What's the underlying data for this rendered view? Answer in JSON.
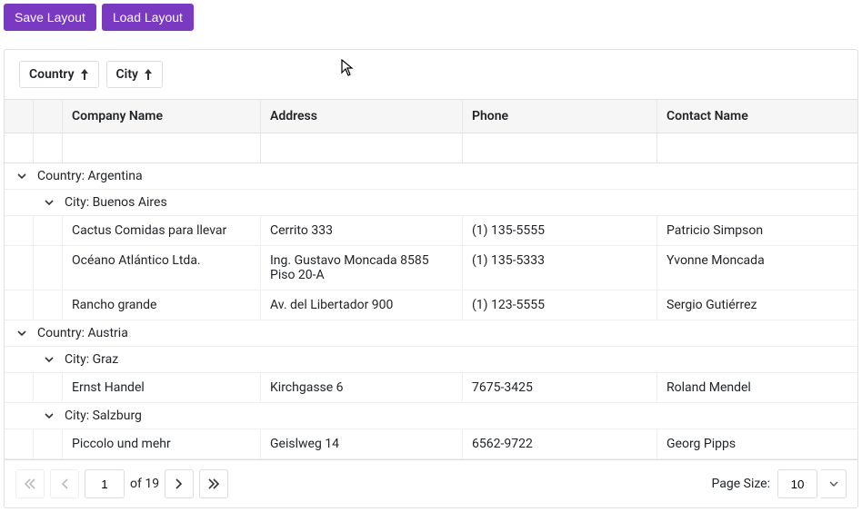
{
  "toolbar": {
    "save": "Save Layout",
    "load": "Load Layout"
  },
  "groupPanel": {
    "chips": [
      {
        "label": "Country"
      },
      {
        "label": "City"
      }
    ]
  },
  "columns": {
    "company": "Company Name",
    "address": "Address",
    "phone": "Phone",
    "contact": "Contact Name"
  },
  "groups": [
    {
      "label": "Country: Argentina",
      "cities": [
        {
          "label": "City: Buenos Aires",
          "rows": [
            {
              "company": "Cactus Comidas para llevar",
              "address": "Cerrito 333",
              "phone": "(1) 135-5555",
              "contact": "Patricio Simpson"
            },
            {
              "company": "Océano Atlántico Ltda.",
              "address": "Ing. Gustavo Moncada 8585 Piso 20-A",
              "phone": "(1) 135-5333",
              "contact": "Yvonne Moncada"
            },
            {
              "company": "Rancho grande",
              "address": "Av. del Libertador 900",
              "phone": "(1) 123-5555",
              "contact": "Sergio Gutiérrez"
            }
          ]
        }
      ]
    },
    {
      "label": "Country: Austria",
      "cities": [
        {
          "label": "City: Graz",
          "rows": [
            {
              "company": "Ernst Handel",
              "address": "Kirchgasse 6",
              "phone": "7675-3425",
              "contact": "Roland Mendel"
            }
          ]
        },
        {
          "label": "City: Salzburg",
          "rows": [
            {
              "company": "Piccolo und mehr",
              "address": "Geislweg 14",
              "phone": "6562-9722",
              "contact": "Georg Pipps"
            }
          ]
        }
      ]
    }
  ],
  "pager": {
    "page": "1",
    "of": "of 19",
    "sizeLabel": "Page Size:",
    "size": "10"
  }
}
